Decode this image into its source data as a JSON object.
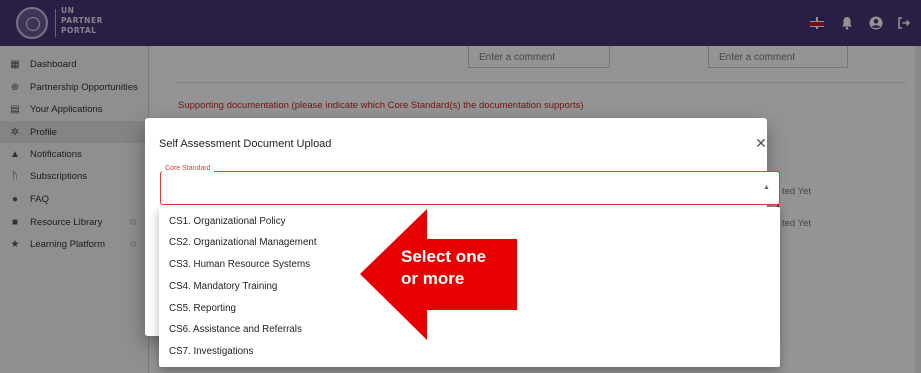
{
  "brand": {
    "line1": "UN",
    "line2": "PARTNER",
    "line3": "PORTAL"
  },
  "header_icons": [
    "uk-flag-icon",
    "bell-icon",
    "account-icon",
    "logout-icon"
  ],
  "sidebar": {
    "items": [
      {
        "label": "Dashboard",
        "icon": "dashboard-icon"
      },
      {
        "label": "Partnership Opportunities",
        "icon": "globe-icon"
      },
      {
        "label": "Your Applications",
        "icon": "applications-icon"
      },
      {
        "label": "Profile",
        "icon": "gear-icon",
        "active": true
      },
      {
        "label": "Notifications",
        "icon": "bell-icon"
      },
      {
        "label": "Subscriptions",
        "icon": "rss-icon"
      },
      {
        "label": "FAQ",
        "icon": "help-icon"
      },
      {
        "label": "Resource Library",
        "icon": "book-icon",
        "external": true
      },
      {
        "label": "Learning Platform",
        "icon": "star-icon",
        "external": true
      }
    ]
  },
  "background": {
    "comment_placeholder_1": "Enter a comment",
    "comment_placeholder_2": "Enter a comment",
    "supporting_doc_text": "Supporting documentation (please indicate which Core Standard(s) the documentation supports)",
    "status_1": "ted Yet",
    "status_2": "ted Yet"
  },
  "dialog": {
    "title": "Self Assessment Document Upload",
    "field_label": "Core Standard",
    "options": [
      "CS1. Organizational Policy",
      "CS2. Organizational Management",
      "CS3. Human Resource Systems",
      "CS4. Mandatory Training",
      "CS5. Reporting",
      "CS6. Assistance and Referrals",
      "CS7. Investigations"
    ]
  },
  "annotation": {
    "line1": "Select one",
    "line2": "or more"
  },
  "colors": {
    "header": "#4a3577",
    "accent_red": "#e53935",
    "annotation_red": "#e60000"
  }
}
